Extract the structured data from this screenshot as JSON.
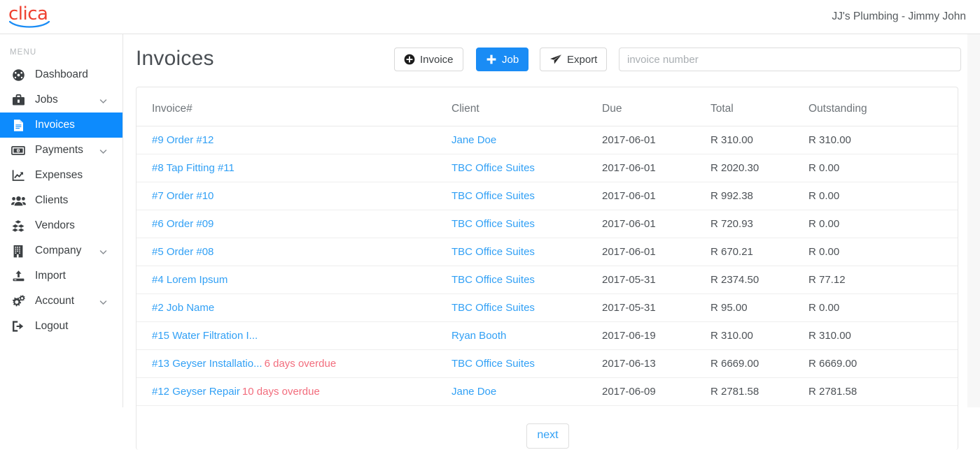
{
  "brand": {
    "logo_text": "clica",
    "logo_color": "#ef4130",
    "swoosh_color": "#1a8cf5"
  },
  "header": {
    "company_user": "JJ's Plumbing - Jimmy John"
  },
  "sidebar": {
    "menu_label": "MENU",
    "active_color": "#0d8bfd",
    "items": [
      {
        "label": "Dashboard",
        "icon": "gauge-icon",
        "expandable": false,
        "active": false
      },
      {
        "label": "Jobs",
        "icon": "briefcase-icon",
        "expandable": true,
        "active": false
      },
      {
        "label": "Invoices",
        "icon": "document-icon",
        "expandable": false,
        "active": true
      },
      {
        "label": "Payments",
        "icon": "money-icon",
        "expandable": true,
        "active": false
      },
      {
        "label": "Expenses",
        "icon": "chart-icon",
        "expandable": false,
        "active": false
      },
      {
        "label": "Clients",
        "icon": "people-icon",
        "expandable": false,
        "active": false
      },
      {
        "label": "Vendors",
        "icon": "boxes-icon",
        "expandable": false,
        "active": false
      },
      {
        "label": "Company",
        "icon": "building-icon",
        "expandable": true,
        "active": false
      },
      {
        "label": "Import",
        "icon": "upload-icon",
        "expandable": false,
        "active": false
      },
      {
        "label": "Account",
        "icon": "gears-icon",
        "expandable": true,
        "active": false
      },
      {
        "label": "Logout",
        "icon": "signout-icon",
        "expandable": false,
        "active": false
      }
    ]
  },
  "main": {
    "title": "Invoices",
    "buttons": {
      "invoice": {
        "label": "Invoice",
        "icon": "plus-circle-icon"
      },
      "job": {
        "label": "Job",
        "icon": "plus-icon",
        "accent": "#1a8cf5"
      },
      "export": {
        "label": "Export",
        "icon": "paper-plane-icon"
      }
    },
    "search": {
      "placeholder": "invoice number",
      "value": ""
    },
    "table": {
      "columns": [
        "Invoice#",
        "Client",
        "Due",
        "Total",
        "Outstanding"
      ],
      "rows": [
        {
          "invoice": "#9 Order #12",
          "overdue": "",
          "client": "Jane Doe",
          "due": "2017-06-01",
          "total": "R 310.00",
          "outstanding": "R 310.00"
        },
        {
          "invoice": "#8 Tap Fitting #11",
          "overdue": "",
          "client": "TBC Office Suites",
          "due": "2017-06-01",
          "total": "R 2020.30",
          "outstanding": "R 0.00"
        },
        {
          "invoice": "#7 Order #10",
          "overdue": "",
          "client": "TBC Office Suites",
          "due": "2017-06-01",
          "total": "R 992.38",
          "outstanding": "R 0.00"
        },
        {
          "invoice": "#6 Order #09",
          "overdue": "",
          "client": "TBC Office Suites",
          "due": "2017-06-01",
          "total": "R 720.93",
          "outstanding": "R 0.00"
        },
        {
          "invoice": "#5 Order #08",
          "overdue": "",
          "client": "TBC Office Suites",
          "due": "2017-06-01",
          "total": "R 670.21",
          "outstanding": "R 0.00"
        },
        {
          "invoice": "#4 Lorem Ipsum",
          "overdue": "",
          "client": "TBC Office Suites",
          "due": "2017-05-31",
          "total": "R 2374.50",
          "outstanding": "R 77.12"
        },
        {
          "invoice": "#2 Job Name",
          "overdue": "",
          "client": "TBC Office Suites",
          "due": "2017-05-31",
          "total": "R 95.00",
          "outstanding": "R 0.00"
        },
        {
          "invoice": "#15 Water Filtration I...",
          "overdue": "",
          "client": "Ryan Booth",
          "due": "2017-06-19",
          "total": "R 310.00",
          "outstanding": "R 310.00"
        },
        {
          "invoice": "#13 Geyser Installatio...",
          "overdue": "6 days overdue",
          "client": "TBC Office Suites",
          "due": "2017-06-13",
          "total": "R 6669.00",
          "outstanding": "R 6669.00"
        },
        {
          "invoice": "#12 Geyser Repair",
          "overdue": "10 days overdue",
          "client": "Jane Doe",
          "due": "2017-06-09",
          "total": "R 2781.58",
          "outstanding": "R 2781.58"
        }
      ]
    },
    "pagination": {
      "next_label": "next"
    }
  },
  "colors": {
    "link": "#31a0f5",
    "overdue": "#f26d7d",
    "page_bg": "#f7f7f7"
  }
}
